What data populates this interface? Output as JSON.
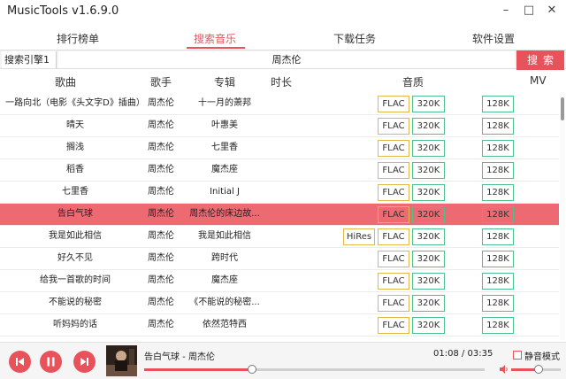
{
  "window": {
    "title": "MusicTools v1.6.9.0",
    "min_glyph": "–",
    "max_glyph": "□",
    "close_glyph": "✕"
  },
  "nav": {
    "tabs": [
      "排行榜单",
      "搜索音乐",
      "下载任务",
      "软件设置"
    ],
    "active_index": 1
  },
  "search": {
    "engine": "搜索引擎1",
    "query": "周杰伦",
    "button_label": "搜索"
  },
  "table": {
    "headers": {
      "song": "歌曲",
      "singer": "歌手",
      "album": "专辑",
      "duration": "时长",
      "quality": "音质",
      "mv": "MV"
    },
    "quality_labels": {
      "hires": "HiRes",
      "flac": "FLAC",
      "q320": "320K",
      "q128": "128K"
    },
    "rows": [
      {
        "song": "一路向北（电影《头文字D》插曲）",
        "singer": "周杰伦",
        "album": "十一月的萧邦",
        "hires": false
      },
      {
        "song": "晴天",
        "singer": "周杰伦",
        "album": "叶惠美",
        "hires": false
      },
      {
        "song": "搁浅",
        "singer": "周杰伦",
        "album": "七里香",
        "hires": false
      },
      {
        "song": "稻香",
        "singer": "周杰伦",
        "album": "魔杰座",
        "hires": false
      },
      {
        "song": "七里香",
        "singer": "周杰伦",
        "album": "Initial J",
        "hires": false
      },
      {
        "song": "告白气球",
        "singer": "周杰伦",
        "album": "周杰伦的床边故...",
        "hires": false,
        "selected": true
      },
      {
        "song": "我是如此相信",
        "singer": "周杰伦",
        "album": "我是如此相信",
        "hires": true
      },
      {
        "song": "好久不见",
        "singer": "周杰伦",
        "album": "跨时代",
        "hires": false
      },
      {
        "song": "给我一首歌的时间",
        "singer": "周杰伦",
        "album": "魔杰座",
        "hires": false
      },
      {
        "song": "不能说的秘密",
        "singer": "周杰伦",
        "album": "《不能说的秘密...",
        "hires": false
      },
      {
        "song": "听妈妈的话",
        "singer": "周杰伦",
        "album": "依然范特西",
        "hires": false
      }
    ]
  },
  "player": {
    "now_playing": "告白气球 - 周杰伦",
    "elapsed": "01:08",
    "total": "03:35",
    "time_display": "01:08 / 03:35",
    "progress_fraction": 0.316,
    "volume_fraction": 0.55,
    "mute_label": "静音模式",
    "muted": false
  },
  "colors": {
    "accent": "#e8525a",
    "selected_row": "#ee6a72",
    "flac_border": "#e0b84b",
    "mp3_border": "#4fc08d"
  }
}
